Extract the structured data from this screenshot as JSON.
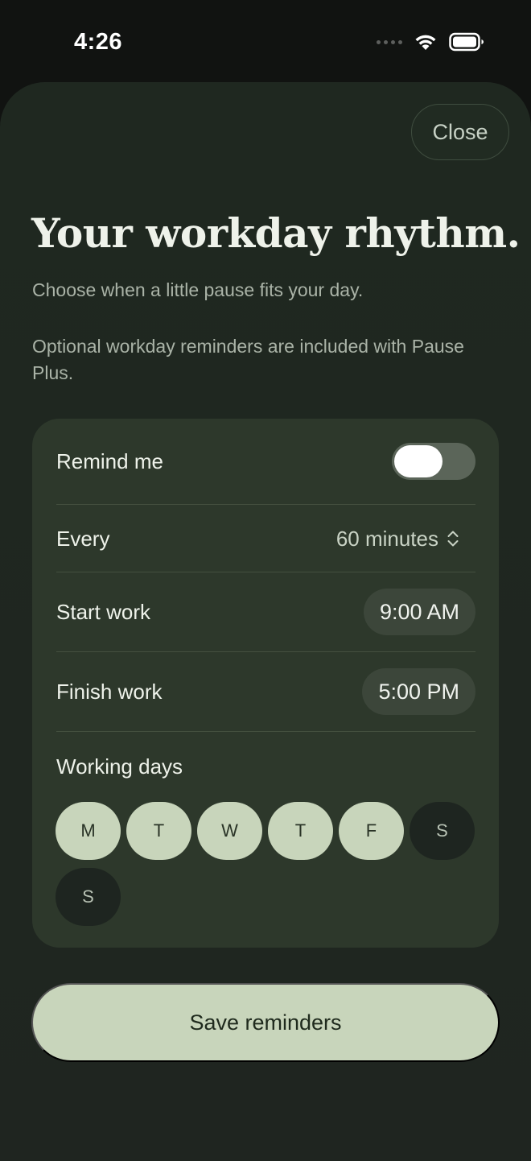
{
  "status_bar": {
    "time": "4:26"
  },
  "header": {
    "close_label": "Close"
  },
  "main": {
    "title": "Your workday rhythm.",
    "subtitle": "Choose when a little pause fits your day.",
    "plus_note": "Optional workday reminders are included with Pause Plus."
  },
  "settings": {
    "remind_me_label": "Remind me",
    "remind_me_enabled": true,
    "every_label": "Every",
    "every_value": "60 minutes",
    "start_label": "Start work",
    "start_value": "9:00 AM",
    "finish_label": "Finish work",
    "finish_value": "5:00 PM",
    "days_label": "Working days",
    "days": [
      {
        "label": "M",
        "selected": true
      },
      {
        "label": "T",
        "selected": true
      },
      {
        "label": "W",
        "selected": true
      },
      {
        "label": "T",
        "selected": true
      },
      {
        "label": "F",
        "selected": true
      },
      {
        "label": "S",
        "selected": false
      },
      {
        "label": "S",
        "selected": false
      }
    ]
  },
  "footer": {
    "save_label": "Save reminders"
  },
  "colors": {
    "accent": "#c8d5bb",
    "card": "#2d382b",
    "sheet": "#1f2820",
    "background": "#111311"
  }
}
